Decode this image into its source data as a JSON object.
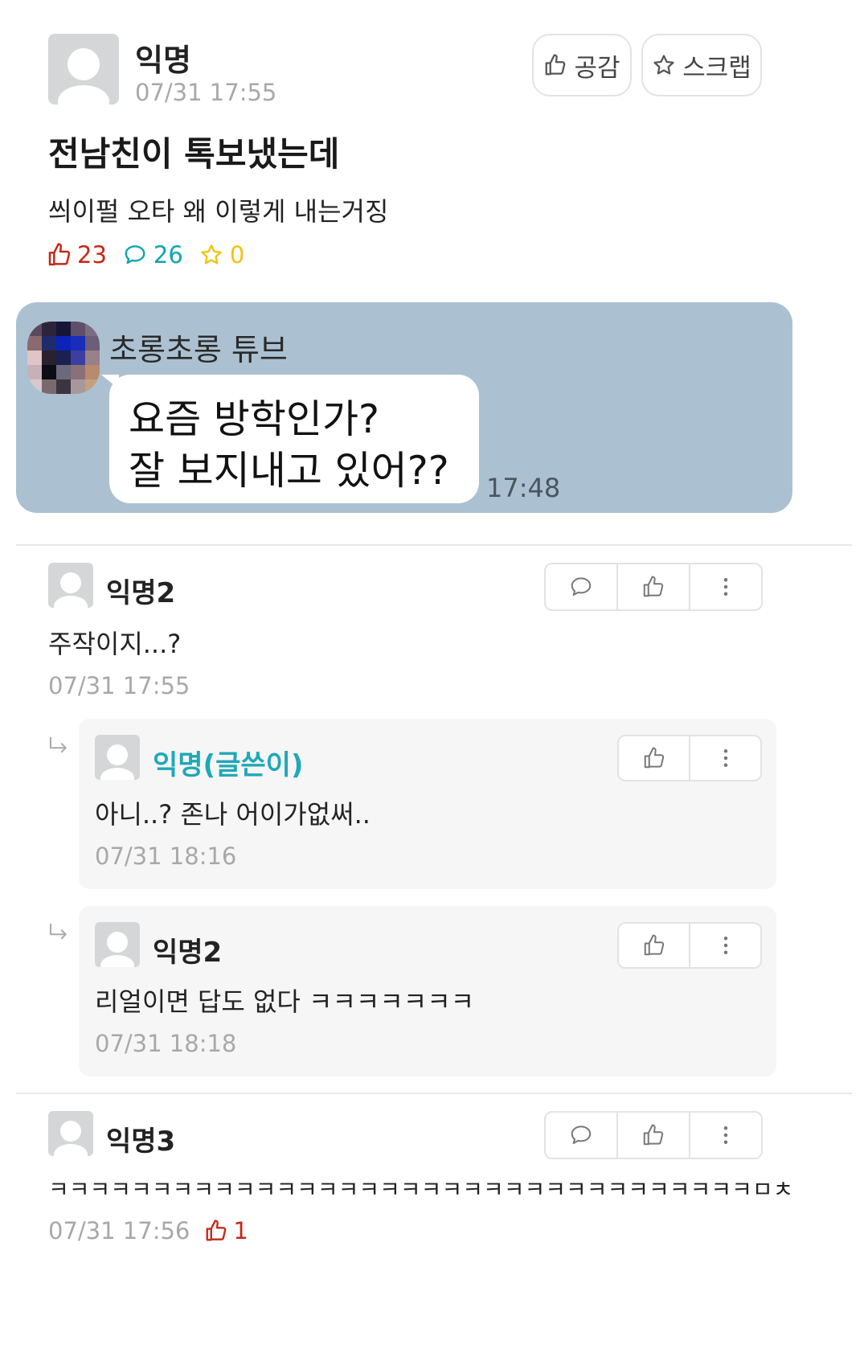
{
  "post": {
    "author": "익명",
    "time": "07/31 17:55",
    "like_btn": "공감",
    "scrap_btn": "스크랩",
    "title": "전남친이 톡보냈는데",
    "body": "씌이펄 오타 왜 이렇게 내는거징",
    "likes": "23",
    "comments": "26",
    "scraps": "0"
  },
  "chat": {
    "sender": "초롱초롱 튜브",
    "line1": "요즘 방학인가?",
    "line2": "잘 보지내고 있어??",
    "time": "17:48"
  },
  "comments": [
    {
      "author": "익명2",
      "text": "주작이지...?",
      "time": "07/31 17:55",
      "replies": [
        {
          "author": "익명(글쓴이)",
          "text": "아니..? 존나 어이가없써..",
          "time": "07/31 18:16"
        },
        {
          "author": "익명2",
          "text": "리얼이면 답도 없다 ㅋㅋㅋㅋㅋㅋㅋ",
          "time": "07/31 18:18"
        }
      ]
    },
    {
      "author": "익명3",
      "text": "ㅋㅋㅋㅋㅋㅋㅋㅋㅋㅋㅋㅋㅋㅋㅋㅋㅋㅋㅋㅋㅋㅋㅋㅋㅋㅋㅋㅋㅋㅋㅋㅋㅋㅋㅁㅊ",
      "time": "07/31 17:56",
      "likes": "1"
    }
  ],
  "colors": {
    "like_red": "#c62917",
    "comment_teal": "#0ca5b0",
    "scrap_yellow": "#f1c40f",
    "chat_bg": "#abc1d1",
    "op_name": "#1fa8b8"
  }
}
